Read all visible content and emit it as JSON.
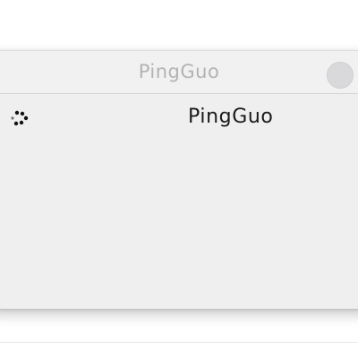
{
  "window": {
    "title": "PingGuo"
  },
  "content": {
    "item_label": "PingGuo",
    "status_icon": "loading-spinner-icon"
  }
}
